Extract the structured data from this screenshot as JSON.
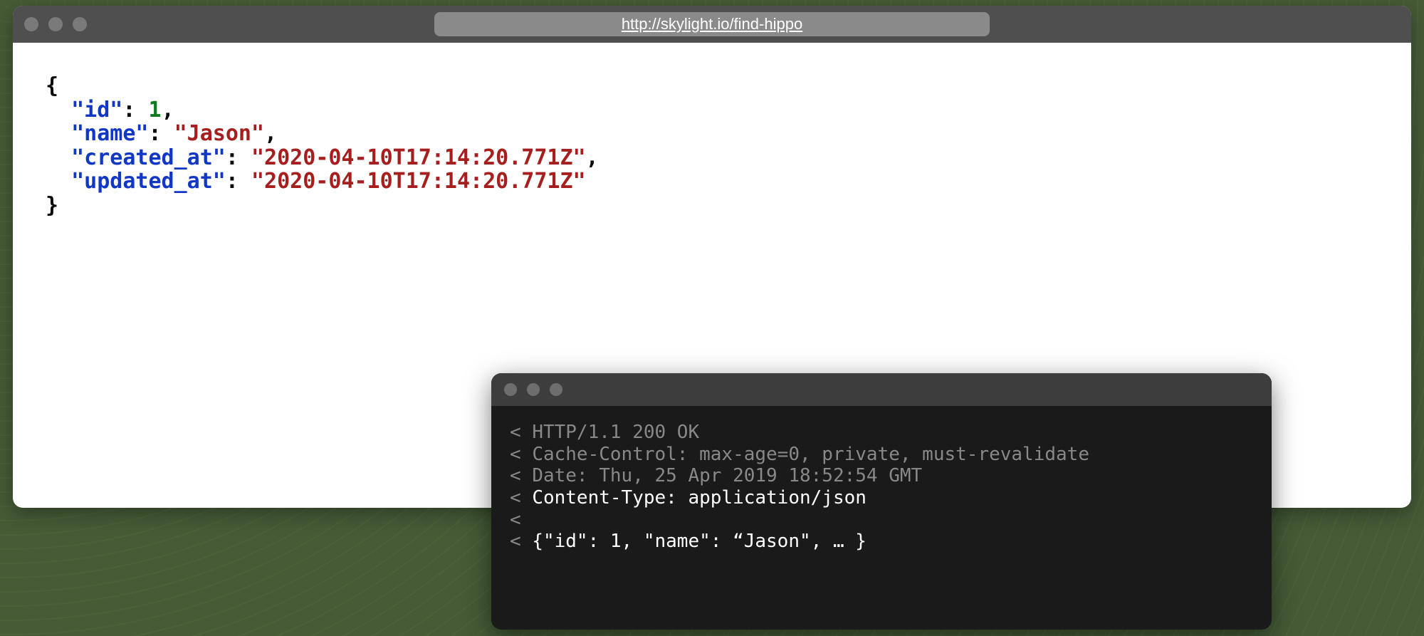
{
  "browser": {
    "url": "http://skylight.io/find-hippo",
    "json": {
      "open": "{",
      "close": "}",
      "comma": ",",
      "rows": [
        {
          "indent": "  ",
          "key": "\"id\"",
          "colon": ": ",
          "value": "1",
          "value_class": "num",
          "trail": ","
        },
        {
          "indent": "  ",
          "key": "\"name\"",
          "colon": ": ",
          "value": "\"Jason\"",
          "value_class": "str",
          "trail": ","
        },
        {
          "indent": "  ",
          "key": "\"created_at\"",
          "colon": ": ",
          "value": "\"2020-04-10T17:14:20.771Z\"",
          "value_class": "str",
          "trail": ","
        },
        {
          "indent": "  ",
          "key": "\"updated_at\"",
          "colon": ": ",
          "value": "\"2020-04-10T17:14:20.771Z\"",
          "value_class": "str",
          "trail": ""
        }
      ]
    }
  },
  "terminal": {
    "lines": [
      {
        "prefix": "< ",
        "text": "HTTP/1.1 200 OK",
        "highlighted": false
      },
      {
        "prefix": "< ",
        "text": "Cache-Control: max-age=0, private, must-revalidate",
        "highlighted": false
      },
      {
        "prefix": "< ",
        "text": "Date: Thu, 25 Apr 2019 18:52:54 GMT",
        "highlighted": false
      },
      {
        "prefix": "< ",
        "text": "Content-Type: application/json",
        "highlighted": true
      },
      {
        "prefix": "<",
        "text": "",
        "highlighted": false
      },
      {
        "prefix": "< ",
        "text": "{\"id\": 1, \"name\": “Jason\", … }",
        "highlighted": true
      }
    ]
  }
}
